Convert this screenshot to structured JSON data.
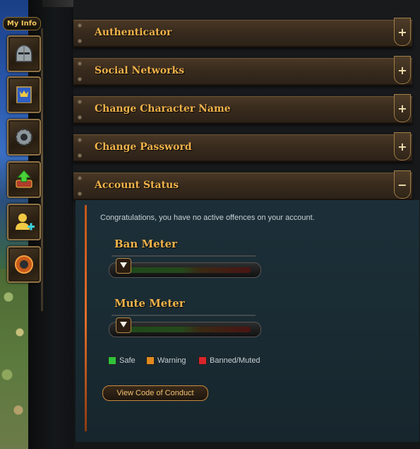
{
  "sidebar": {
    "tab_label": "My Info",
    "buttons": [
      {
        "name": "helmet-icon"
      },
      {
        "name": "banner-icon"
      },
      {
        "name": "gear-icon"
      },
      {
        "name": "upgrade-icon"
      },
      {
        "name": "add-friend-icon"
      },
      {
        "name": "shield-icon"
      }
    ]
  },
  "accordion": [
    {
      "label": "Authenticator",
      "toggle": "+"
    },
    {
      "label": "Social Networks",
      "toggle": "+"
    },
    {
      "label": "Change Character Name",
      "toggle": "+"
    },
    {
      "label": "Change Password",
      "toggle": "+"
    },
    {
      "label": "Account Status",
      "toggle": "−"
    }
  ],
  "account_status": {
    "message": "Congratulations, you have no active offences on your account.",
    "ban_meter": {
      "title": "Ban Meter",
      "level": 0
    },
    "mute_meter": {
      "title": "Mute Meter",
      "level": 0
    },
    "legend": [
      {
        "label": "Safe",
        "color": "#2fc23a"
      },
      {
        "label": "Warning",
        "color": "#e08a1e"
      },
      {
        "label": "Banned/Muted",
        "color": "#d8242a"
      }
    ],
    "conduct_button": "View Code of Conduct"
  }
}
